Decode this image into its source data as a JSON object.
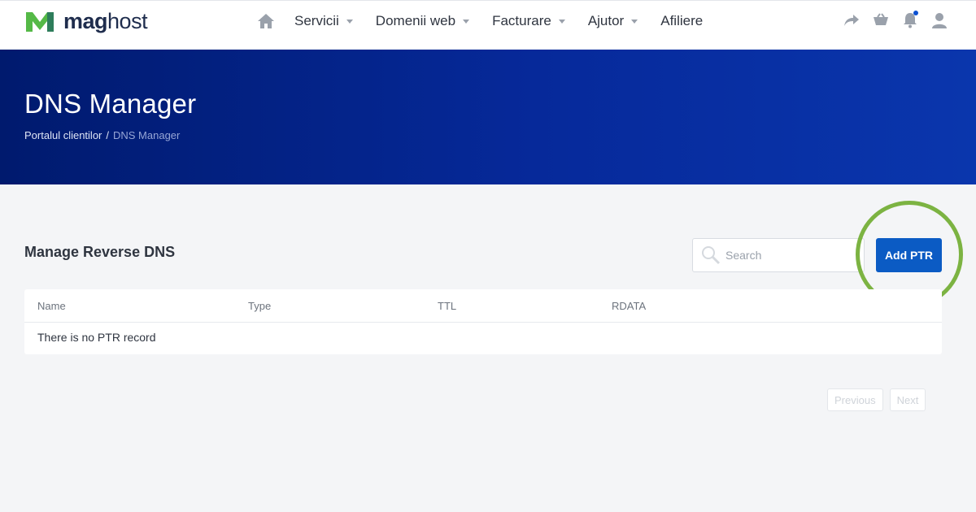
{
  "brand": {
    "name_bold": "mag",
    "name_light": "host",
    "colors": {
      "green": "#55b947",
      "navy": "#1f2d4d"
    }
  },
  "nav": {
    "items": [
      {
        "label": "Servicii",
        "has_dropdown": true
      },
      {
        "label": "Domenii web",
        "has_dropdown": true
      },
      {
        "label": "Facturare",
        "has_dropdown": true
      },
      {
        "label": "Ajutor",
        "has_dropdown": true
      },
      {
        "label": "Afiliere",
        "has_dropdown": false
      }
    ],
    "right_icons": [
      "share-icon",
      "cart-icon",
      "bell-icon",
      "user-icon"
    ]
  },
  "hero": {
    "title": "DNS Manager",
    "breadcrumb": {
      "parent": "Portalul clientilor",
      "separator": "/",
      "current": "DNS Manager"
    }
  },
  "section": {
    "title": "Manage Reverse DNS"
  },
  "search": {
    "placeholder": "Search"
  },
  "actions": {
    "add_label": "Add PTR"
  },
  "table": {
    "columns": [
      "Name",
      "Type",
      "TTL",
      "RDATA"
    ],
    "empty_message": "There is no PTR record"
  },
  "pagination": {
    "previous": "Previous",
    "next": "Next"
  },
  "colors": {
    "hero_start": "#001a6e",
    "hero_end": "#0a36ad",
    "button": "#0b5bc4",
    "highlight": "#7cb342",
    "notification_dot": "#0a4fd1"
  }
}
